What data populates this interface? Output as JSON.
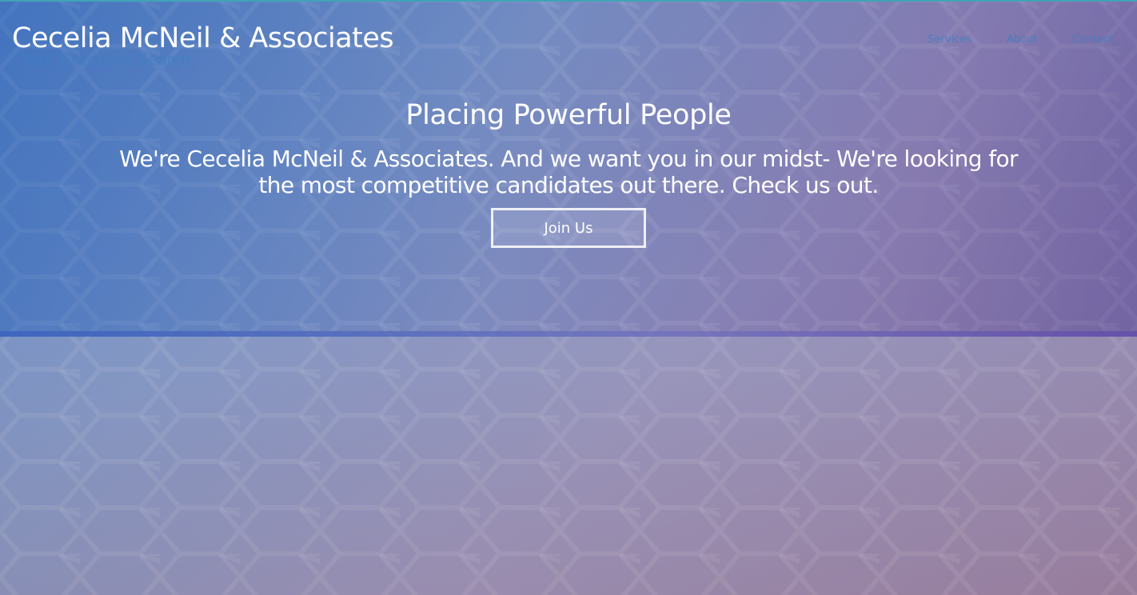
{
  "header": {
    "brand": "Cecelia McNeil & Associates",
    "tagline": "Your Executive Search",
    "nav": [
      "Services",
      "About",
      "Contact"
    ]
  },
  "hero": {
    "title": "Placing Powerful People",
    "description": "We're Cecelia McNeil & Associates. And we want you in our midst- We're looking for the most competitive candidates out there. Check us out.",
    "cta_label": "Join Us"
  },
  "colors": {
    "accent": "#3e7fc6",
    "top_line": "#3fa4b6",
    "text": "#ffffff"
  }
}
